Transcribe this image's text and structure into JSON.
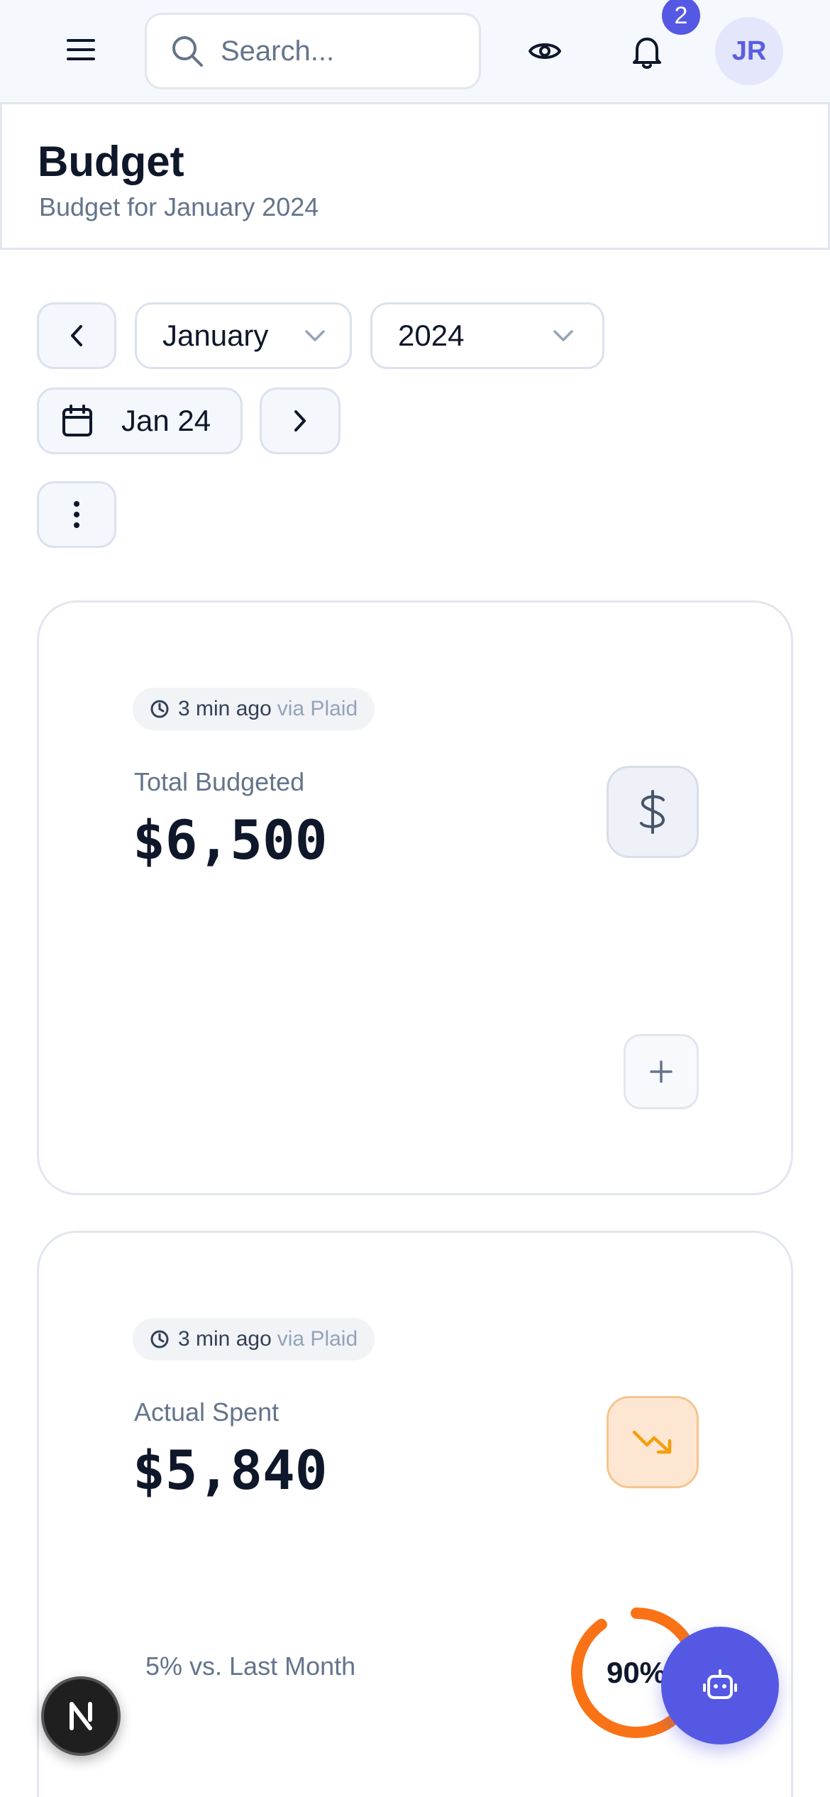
{
  "header": {
    "search_placeholder": "Search...",
    "notification_count": "2",
    "avatar_initials": "JR"
  },
  "page": {
    "title": "Budget",
    "subtitle": "Budget for January 2024"
  },
  "controls": {
    "month": "January",
    "year": "2024",
    "date_label": "Jan 24"
  },
  "cards": [
    {
      "sync_ago": "3 min ago",
      "sync_via": "via Plaid",
      "label": "Total Budgeted",
      "value": "$6,500",
      "icon": "dollar-icon"
    },
    {
      "sync_ago": "3 min ago",
      "sync_via": "via Plaid",
      "label": "Actual Spent",
      "value": "$5,840",
      "icon": "trending-down-icon",
      "trend": "5% vs. Last Month",
      "progress_label": "90%",
      "progress_fraction": 0.9
    }
  ],
  "colors": {
    "accent": "#5558e3",
    "progress": "#f97316"
  }
}
